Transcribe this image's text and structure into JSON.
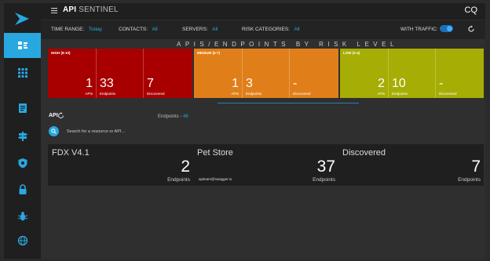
{
  "header": {
    "app_title_bold": "API",
    "app_title_rest": "SENTINEL",
    "user_initials": "CQ"
  },
  "filters": {
    "time_range_label": "TIME RANGE:",
    "time_range_value": "Today",
    "contacts_label": "CONTACTS:",
    "contacts_value": "All",
    "servers_label": "SERVERS:",
    "servers_value": "All",
    "risk_categories_label": "RISK CATEGORIES:",
    "risk_categories_value": "All",
    "with_traffic_label": "WITH TRAFFIC:"
  },
  "risk": {
    "title": "APIS/ENDPOINTS BY RISK LEVEL",
    "high": {
      "label": "HIGH (8-10)",
      "color": "#a80000",
      "apis": "1",
      "endpoints": "33",
      "discovered": "7"
    },
    "medium": {
      "label": "MEDIUM (5-7)",
      "color": "#e07f1a",
      "apis": "1",
      "endpoints": "3",
      "discovered": "-"
    },
    "low": {
      "label": "LOW (0-4)",
      "color": "#a6ad05",
      "apis": "2",
      "endpoints": "10",
      "discovered": "-"
    },
    "cap_apis": "APIs",
    "cap_endpoints": "Endpoints",
    "cap_discovered": "Discovered"
  },
  "api": {
    "label": "API",
    "endpoints_label": "Endpoints - ",
    "endpoints_count": "46",
    "search_placeholder": "Search for a resource or API…"
  },
  "cards": [
    {
      "name": "FDX V4.1",
      "count": "2",
      "caption": "Endpoints",
      "contact": ""
    },
    {
      "name": "Pet Store",
      "count": "37",
      "caption": "Endpoints",
      "contact": "apiteam@swagger.io"
    },
    {
      "name": "Discovered",
      "count": "7",
      "caption": "Endpoints",
      "contact": ""
    }
  ],
  "colors": {
    "accent": "#29a8e0",
    "sidebar": "#1f1f1f",
    "background": "#2f2f2f"
  },
  "sidebar_icons": [
    "logo-chevron-icon",
    "api-dashboard-icon",
    "grid-dots-icon",
    "document-icon",
    "signpost-icon",
    "shield-icon",
    "lock-icon",
    "bug-icon",
    "globe-icon"
  ]
}
